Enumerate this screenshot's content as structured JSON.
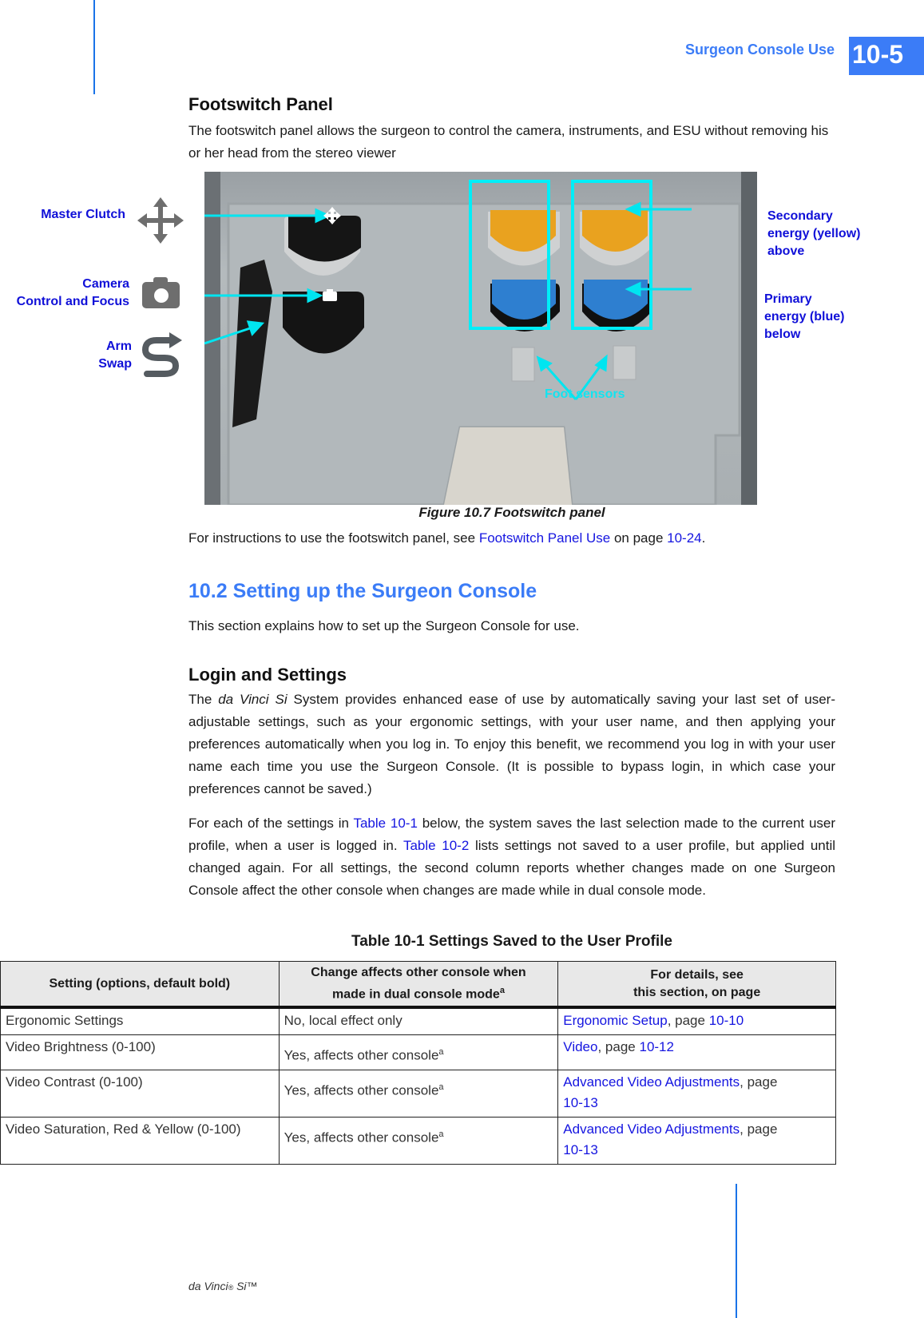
{
  "header": {
    "section_title": "Surgeon Console Use",
    "page_number": "10-5",
    "accent_color": "#3b7cf7"
  },
  "footswitch": {
    "heading": "Footswitch Panel",
    "intro": "The footswitch panel allows the surgeon to control the camera, instruments, and ESU without removing his or her head from the stereo viewer",
    "figure": {
      "caption": "Figure 10.7 Footswitch panel",
      "callouts": {
        "master_clutch": "Master Clutch",
        "camera_line1": "Camera",
        "camera_line2": "Control and Focus",
        "arm_line1": "Arm",
        "arm_line2": "Swap",
        "secondary_line1": "Secondary",
        "secondary_line2": "energy (yellow)",
        "secondary_line3": "above",
        "primary_line1": "Primary",
        "primary_line2": "energy (blue)",
        "primary_line3": "below",
        "foot_sensors": "Foot sensors"
      },
      "icons": [
        "move-arrows-icon",
        "camera-icon",
        "arm-swap-icon"
      ],
      "callout_color": "#00e5f0",
      "label_color": "#1010d8"
    },
    "instructions": {
      "prefix": "For instructions to use the footswitch panel, see ",
      "link_text": "Footswitch Panel Use",
      "middle": " on page ",
      "page_link": "10-24",
      "suffix": "."
    }
  },
  "setup": {
    "heading": "10.2 Setting up the Surgeon Console",
    "intro": "This section explains how to set up the Surgeon Console for use.",
    "login": {
      "heading": "Login and Settings",
      "para1_prefix": "The ",
      "para1_italic": "da Vinci Si",
      "para1_rest": " System provides enhanced ease of use by automatically saving your last set of user-adjustable settings, such as your ergonomic settings, with your user name, and then applying your preferences automatically when you log in. To enjoy this benefit, we recommend you log in with your user name each time you use the Surgeon Console. (It is possible to bypass login, in which case your preferences cannot be saved.)",
      "para2_a": "For each of the settings in ",
      "para2_link1": "Table 10-1",
      "para2_b": " below, the system saves the last selection made to the current user profile, when a user is logged in. ",
      "para2_link2": "Table 10-2",
      "para2_c": " lists settings not saved to a user profile, but applied until changed again. For all settings, the second column reports whether changes made on one Surgeon Console affect the other console when changes are made while in dual console mode."
    }
  },
  "table": {
    "title": "Table 10-1 Settings Saved to the User Profile",
    "headers": {
      "col1": "Setting (options, default bold)",
      "col2_line1": "Change affects other console when",
      "col2_line2": "made in dual console mode",
      "col2_sup": "a",
      "col3_line1": "For details, see",
      "col3_line2": "this section, on page"
    },
    "rows": [
      {
        "setting": "Ergonomic Settings",
        "affects": "No, local effect only",
        "affects_sup": "",
        "link": "Ergonomic Setup",
        "page_prefix": ", page ",
        "page": "10-10"
      },
      {
        "setting": "Video Brightness (0-100)",
        "affects": "Yes, affects other console",
        "affects_sup": "a",
        "link": "Video",
        "page_prefix": ", page ",
        "page": "10-12"
      },
      {
        "setting": "Video Contrast (0-100)",
        "affects": "Yes, affects other console",
        "affects_sup": "a",
        "link": "Advanced Video Adjustments",
        "page_prefix": ", page ",
        "page": "10-13"
      },
      {
        "setting": "Video Saturation, Red & Yellow (0-100)",
        "affects": "Yes, affects other console",
        "affects_sup": "a",
        "link": "Advanced Video Adjustments",
        "page_prefix": ", page ",
        "page": "10-13"
      }
    ]
  },
  "footer": {
    "product": "da Vinci",
    "reg": "®",
    "model": " Si™"
  }
}
